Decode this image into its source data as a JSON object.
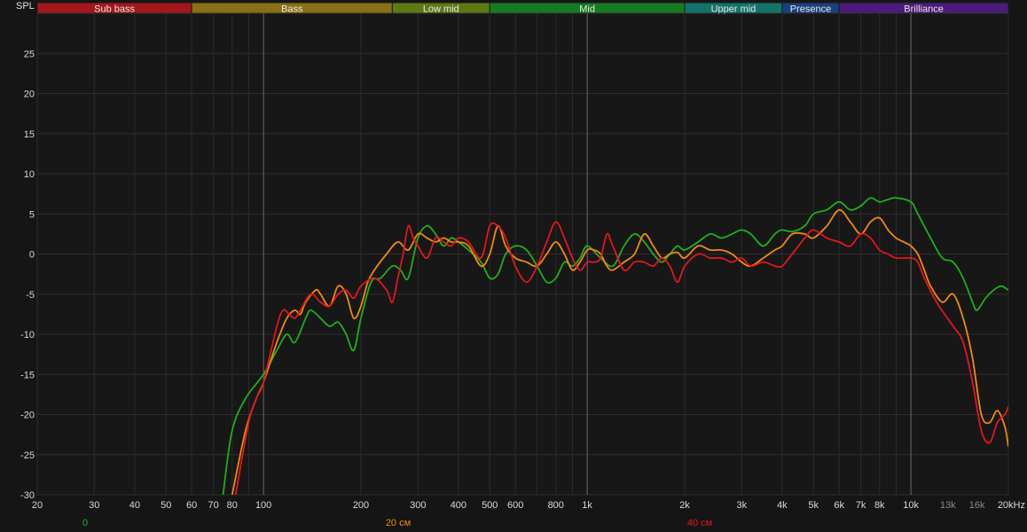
{
  "chart_data": {
    "type": "line",
    "ylabel": "SPL",
    "x_scale": "log",
    "xlim": [
      20,
      20000
    ],
    "ylim": [
      -30,
      30
    ],
    "grid": true,
    "bands": [
      {
        "label": "Sub bass",
        "from": 20,
        "to": 60,
        "color": "#a3171b"
      },
      {
        "label": "Bass",
        "from": 60,
        "to": 250,
        "color": "#8a6f14"
      },
      {
        "label": "Low mid",
        "from": 250,
        "to": 500,
        "color": "#5c7a14"
      },
      {
        "label": "Mid",
        "from": 500,
        "to": 2000,
        "color": "#157a22"
      },
      {
        "label": "Upper mid",
        "from": 2000,
        "to": 4000,
        "color": "#137368"
      },
      {
        "label": "Presence",
        "from": 4000,
        "to": 6000,
        "color": "#1b3f7a"
      },
      {
        "label": "Brilliance",
        "from": 6000,
        "to": 20000,
        "color": "#4a1b7a"
      }
    ],
    "y_ticks": [
      25,
      20,
      15,
      10,
      5,
      0,
      -5,
      -10,
      -15,
      -20,
      -25,
      -30
    ],
    "x_ticks": [
      {
        "v": 20,
        "t": "20"
      },
      {
        "v": 30,
        "t": "30"
      },
      {
        "v": 40,
        "t": "40"
      },
      {
        "v": 50,
        "t": "50"
      },
      {
        "v": 60,
        "t": "60"
      },
      {
        "v": 70,
        "t": "70"
      },
      {
        "v": 80,
        "t": "80"
      },
      {
        "v": 100,
        "t": "100"
      },
      {
        "v": 200,
        "t": "200"
      },
      {
        "v": 300,
        "t": "300"
      },
      {
        "v": 400,
        "t": "400"
      },
      {
        "v": 500,
        "t": "500"
      },
      {
        "v": 600,
        "t": "600"
      },
      {
        "v": 800,
        "t": "800"
      },
      {
        "v": 1000,
        "t": "1k"
      },
      {
        "v": 2000,
        "t": "2k"
      },
      {
        "v": 3000,
        "t": "3k"
      },
      {
        "v": 4000,
        "t": "4k"
      },
      {
        "v": 5000,
        "t": "5k"
      },
      {
        "v": 6000,
        "t": "6k"
      },
      {
        "v": 7000,
        "t": "7k"
      },
      {
        "v": 8000,
        "t": "8k"
      },
      {
        "v": 10000,
        "t": "10k"
      },
      {
        "v": 13000,
        "t": "13k",
        "dim": true
      },
      {
        "v": 16000,
        "t": "16k",
        "dim": true
      },
      {
        "v": 20000,
        "t": "20kHz"
      }
    ],
    "series": [
      {
        "name": "0",
        "color": "#1fae1f",
        "points": [
          [
            75,
            -30
          ],
          [
            80,
            -22
          ],
          [
            88,
            -18
          ],
          [
            100,
            -15
          ],
          [
            110,
            -12
          ],
          [
            118,
            -10
          ],
          [
            125,
            -11
          ],
          [
            135,
            -8
          ],
          [
            140,
            -7
          ],
          [
            150,
            -8
          ],
          [
            160,
            -9
          ],
          [
            170,
            -8.5
          ],
          [
            180,
            -10
          ],
          [
            190,
            -12
          ],
          [
            200,
            -8
          ],
          [
            215,
            -3.5
          ],
          [
            230,
            -3
          ],
          [
            250,
            -1.5
          ],
          [
            265,
            -2
          ],
          [
            280,
            -3
          ],
          [
            300,
            2
          ],
          [
            320,
            3.5
          ],
          [
            340,
            2.5
          ],
          [
            360,
            1
          ],
          [
            380,
            2
          ],
          [
            400,
            1.5
          ],
          [
            430,
            0.5
          ],
          [
            470,
            -1
          ],
          [
            500,
            -3
          ],
          [
            530,
            -2.5
          ],
          [
            560,
            0
          ],
          [
            600,
            1
          ],
          [
            650,
            0.5
          ],
          [
            700,
            -1.5
          ],
          [
            750,
            -3.5
          ],
          [
            800,
            -3
          ],
          [
            850,
            -1
          ],
          [
            900,
            -1.5
          ],
          [
            950,
            -0.5
          ],
          [
            1000,
            1
          ],
          [
            1100,
            -0.5
          ],
          [
            1200,
            -1.5
          ],
          [
            1300,
            1
          ],
          [
            1400,
            2.5
          ],
          [
            1500,
            1.5
          ],
          [
            1600,
            0
          ],
          [
            1700,
            -1
          ],
          [
            1800,
            0
          ],
          [
            1900,
            1
          ],
          [
            2000,
            0.5
          ],
          [
            2200,
            1.5
          ],
          [
            2400,
            2.5
          ],
          [
            2600,
            2
          ],
          [
            2800,
            2.5
          ],
          [
            3000,
            3
          ],
          [
            3200,
            2.5
          ],
          [
            3500,
            1
          ],
          [
            3800,
            2.5
          ],
          [
            4000,
            3
          ],
          [
            4300,
            2.8
          ],
          [
            4700,
            3.5
          ],
          [
            5000,
            5
          ],
          [
            5500,
            5.5
          ],
          [
            6000,
            6.5
          ],
          [
            6500,
            5.5
          ],
          [
            7000,
            6
          ],
          [
            7500,
            7
          ],
          [
            8000,
            6.5
          ],
          [
            8500,
            6.8
          ],
          [
            9000,
            7
          ],
          [
            10000,
            6.5
          ],
          [
            10500,
            5
          ],
          [
            11500,
            2
          ],
          [
            12500,
            -0.5
          ],
          [
            13500,
            -1
          ],
          [
            14500,
            -3
          ],
          [
            15500,
            -6
          ],
          [
            16000,
            -7
          ],
          [
            17000,
            -5.5
          ],
          [
            18000,
            -4.5
          ],
          [
            19000,
            -4
          ],
          [
            20000,
            -4.5
          ]
        ]
      },
      {
        "name": "20 см",
        "color": "#f08a0c",
        "points": [
          [
            80,
            -30
          ],
          [
            88,
            -22
          ],
          [
            95,
            -18
          ],
          [
            100,
            -16
          ],
          [
            110,
            -11
          ],
          [
            118,
            -8
          ],
          [
            125,
            -7
          ],
          [
            130,
            -7.5
          ],
          [
            135,
            -6
          ],
          [
            145,
            -4.5
          ],
          [
            150,
            -5
          ],
          [
            160,
            -6.5
          ],
          [
            170,
            -4
          ],
          [
            180,
            -5
          ],
          [
            190,
            -8
          ],
          [
            200,
            -6.5
          ],
          [
            210,
            -3.5
          ],
          [
            220,
            -2
          ],
          [
            240,
            0
          ],
          [
            260,
            1.5
          ],
          [
            280,
            0.5
          ],
          [
            300,
            2.5
          ],
          [
            320,
            2
          ],
          [
            340,
            1.5
          ],
          [
            360,
            2
          ],
          [
            380,
            1.5
          ],
          [
            400,
            1.5
          ],
          [
            430,
            1
          ],
          [
            470,
            -1.5
          ],
          [
            500,
            0
          ],
          [
            530,
            3.5
          ],
          [
            560,
            1
          ],
          [
            600,
            -0.5
          ],
          [
            650,
            -1
          ],
          [
            700,
            -1.5
          ],
          [
            750,
            0
          ],
          [
            800,
            1.5
          ],
          [
            850,
            0
          ],
          [
            900,
            -2
          ],
          [
            950,
            -1
          ],
          [
            1000,
            0.5
          ],
          [
            1050,
            0.5
          ],
          [
            1100,
            0
          ],
          [
            1150,
            -1.5
          ],
          [
            1200,
            -2
          ],
          [
            1300,
            -1
          ],
          [
            1400,
            0
          ],
          [
            1500,
            2.5
          ],
          [
            1600,
            1
          ],
          [
            1700,
            -0.5
          ],
          [
            1800,
            0
          ],
          [
            1900,
            0.2
          ],
          [
            2000,
            -0.5
          ],
          [
            2200,
            1
          ],
          [
            2400,
            0.5
          ],
          [
            2600,
            0.5
          ],
          [
            2800,
            0
          ],
          [
            3000,
            -1
          ],
          [
            3200,
            -1.5
          ],
          [
            3500,
            -0.5
          ],
          [
            3800,
            0.5
          ],
          [
            4000,
            1
          ],
          [
            4300,
            2.5
          ],
          [
            4700,
            2.5
          ],
          [
            5000,
            2
          ],
          [
            5500,
            3.5
          ],
          [
            6000,
            5.5
          ],
          [
            6500,
            4
          ],
          [
            7000,
            2.5
          ],
          [
            7500,
            4
          ],
          [
            8000,
            4.5
          ],
          [
            8500,
            3
          ],
          [
            9000,
            2
          ],
          [
            9500,
            1.5
          ],
          [
            10000,
            1
          ],
          [
            10500,
            0
          ],
          [
            11000,
            -2
          ],
          [
            11500,
            -4
          ],
          [
            12500,
            -6
          ],
          [
            13500,
            -5
          ],
          [
            14500,
            -8
          ],
          [
            15500,
            -13
          ],
          [
            16500,
            -20
          ],
          [
            17500,
            -21
          ],
          [
            18500,
            -19.5
          ],
          [
            19500,
            -21.5
          ],
          [
            20000,
            -24
          ]
        ]
      },
      {
        "name": "40 см",
        "color": "#e0171f",
        "points": [
          [
            82,
            -30
          ],
          [
            90,
            -21
          ],
          [
            95,
            -18
          ],
          [
            100,
            -16
          ],
          [
            110,
            -9
          ],
          [
            115,
            -7
          ],
          [
            120,
            -7.5
          ],
          [
            125,
            -8
          ],
          [
            130,
            -7
          ],
          [
            140,
            -5
          ],
          [
            150,
            -6
          ],
          [
            160,
            -6.5
          ],
          [
            170,
            -5
          ],
          [
            180,
            -4.5
          ],
          [
            190,
            -5.5
          ],
          [
            200,
            -4
          ],
          [
            220,
            -3
          ],
          [
            240,
            -4.5
          ],
          [
            250,
            -6
          ],
          [
            260,
            -3
          ],
          [
            270,
            0
          ],
          [
            280,
            3.5
          ],
          [
            290,
            2
          ],
          [
            300,
            1
          ],
          [
            320,
            -0.5
          ],
          [
            340,
            2
          ],
          [
            360,
            1.5
          ],
          [
            380,
            1
          ],
          [
            400,
            2
          ],
          [
            430,
            1.5
          ],
          [
            470,
            -0.5
          ],
          [
            500,
            3.5
          ],
          [
            530,
            3.5
          ],
          [
            560,
            2
          ],
          [
            600,
            -1.5
          ],
          [
            650,
            -3.5
          ],
          [
            700,
            -1.5
          ],
          [
            750,
            1.5
          ],
          [
            800,
            4
          ],
          [
            850,
            2
          ],
          [
            900,
            -0.5
          ],
          [
            950,
            -2
          ],
          [
            1000,
            -1
          ],
          [
            1050,
            -1
          ],
          [
            1100,
            -0.5
          ],
          [
            1150,
            2.5
          ],
          [
            1200,
            1
          ],
          [
            1300,
            -2
          ],
          [
            1400,
            -1
          ],
          [
            1500,
            -1
          ],
          [
            1600,
            -1.5
          ],
          [
            1700,
            -0.5
          ],
          [
            1800,
            -1.5
          ],
          [
            1900,
            -3.5
          ],
          [
            2000,
            -1.5
          ],
          [
            2200,
            0
          ],
          [
            2400,
            -0.5
          ],
          [
            2600,
            -0.5
          ],
          [
            2800,
            -1
          ],
          [
            3000,
            -0.5
          ],
          [
            3200,
            -1.5
          ],
          [
            3500,
            -1
          ],
          [
            3800,
            -1.5
          ],
          [
            4000,
            -1.5
          ],
          [
            4300,
            0
          ],
          [
            4700,
            2
          ],
          [
            5000,
            3
          ],
          [
            5500,
            2
          ],
          [
            6000,
            1.5
          ],
          [
            6500,
            1
          ],
          [
            7000,
            2.5
          ],
          [
            7500,
            2
          ],
          [
            8000,
            0.5
          ],
          [
            8500,
            0
          ],
          [
            9000,
            -0.5
          ],
          [
            10000,
            -0.5
          ],
          [
            10500,
            -1
          ],
          [
            11000,
            -3
          ],
          [
            12000,
            -6
          ],
          [
            13500,
            -9
          ],
          [
            14500,
            -11
          ],
          [
            15500,
            -16
          ],
          [
            16500,
            -22
          ],
          [
            17500,
            -23.5
          ],
          [
            18500,
            -21
          ],
          [
            19500,
            -20
          ],
          [
            20000,
            -19
          ]
        ]
      }
    ]
  }
}
